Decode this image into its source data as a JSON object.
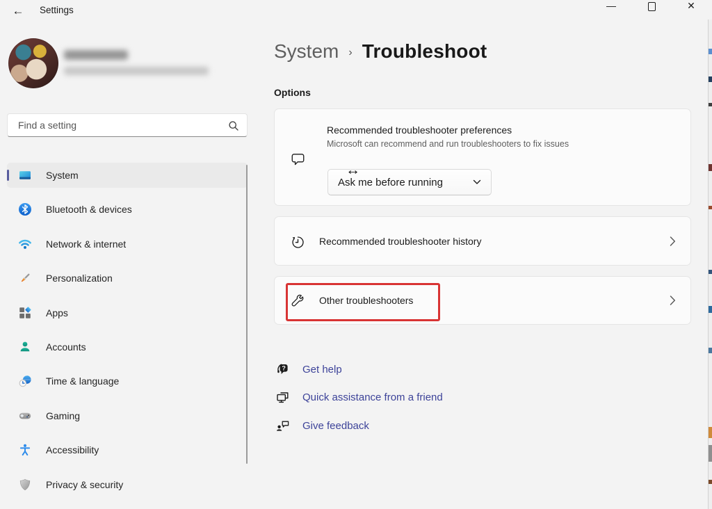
{
  "titlebar": {
    "title": "Settings",
    "back_glyph": "←",
    "minimize_glyph": "—",
    "close_glyph": "✕"
  },
  "sidebar": {
    "search_placeholder": "Find a setting",
    "items": [
      {
        "label": "System",
        "icon": "system-icon",
        "selected": true
      },
      {
        "label": "Bluetooth & devices",
        "icon": "bluetooth-icon",
        "selected": false
      },
      {
        "label": "Network & internet",
        "icon": "network-icon",
        "selected": false
      },
      {
        "label": "Personalization",
        "icon": "personalization-icon",
        "selected": false
      },
      {
        "label": "Apps",
        "icon": "apps-icon",
        "selected": false
      },
      {
        "label": "Accounts",
        "icon": "accounts-icon",
        "selected": false
      },
      {
        "label": "Time & language",
        "icon": "time-language-icon",
        "selected": false
      },
      {
        "label": "Gaming",
        "icon": "gaming-icon",
        "selected": false
      },
      {
        "label": "Accessibility",
        "icon": "accessibility-icon",
        "selected": false
      },
      {
        "label": "Privacy & security",
        "icon": "privacy-security-icon",
        "selected": false
      }
    ]
  },
  "breadcrumb": {
    "parent": "System",
    "separator": "›",
    "current": "Troubleshoot"
  },
  "main": {
    "section_label": "Options",
    "cards": [
      {
        "title": "Recommended troubleshooter preferences",
        "description": "Microsoft can recommend and run troubleshooters to fix issues",
        "dropdown_value": "Ask me before running",
        "icon": "comment-bubble-icon"
      },
      {
        "title": "Recommended troubleshooter history",
        "icon": "history-icon"
      },
      {
        "title": "Other troubleshooters",
        "icon": "wrench-icon",
        "highlighted": true
      }
    ],
    "links": [
      {
        "label": "Get help",
        "icon": "get-help-icon"
      },
      {
        "label": "Quick assistance from a friend",
        "icon": "remote-assistance-icon"
      },
      {
        "label": "Give feedback",
        "icon": "feedback-icon"
      }
    ]
  },
  "cursor": {
    "type": "horizontal-resize",
    "glyph": "↔"
  },
  "colors": {
    "window_bg": "#f3f3f3",
    "card_bg": "#fbfbfb",
    "selected_item_bg": "#eaeaea",
    "accent_pill": "#585c9e",
    "link": "#3d4399",
    "highlight_red": "#d83434"
  }
}
